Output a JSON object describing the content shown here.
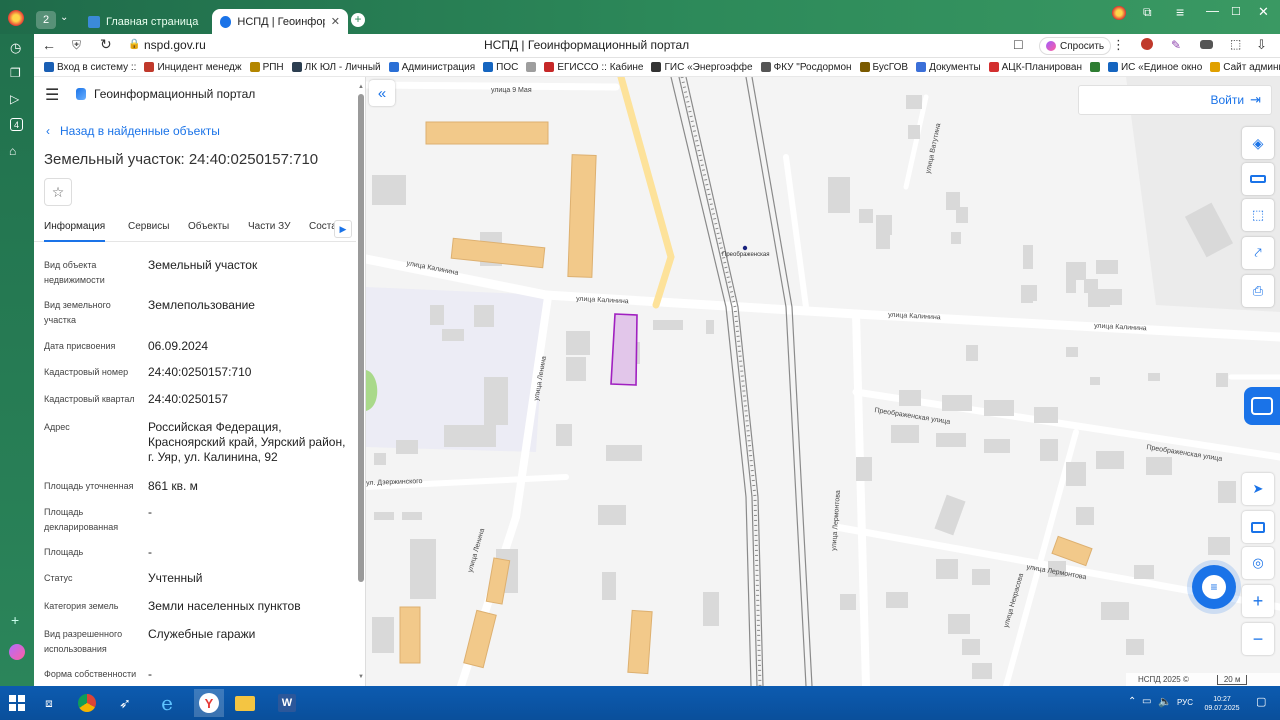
{
  "browser": {
    "tab_count": "2",
    "tabs": [
      {
        "title": "Главная страница",
        "active": false
      },
      {
        "title": "НСПД | Геоинформацио",
        "active": true
      }
    ],
    "address": "nspd.gov.ru",
    "page_title": "НСПД | Геоинформационный портал",
    "ask_label": "Спросить",
    "bookmarks": [
      {
        "label": "Вход в систему ::",
        "color": "#1a5fb4"
      },
      {
        "label": "Инцидент менедж",
        "color": "#c0392b"
      },
      {
        "label": "РПН",
        "color": "#b38600"
      },
      {
        "label": "ЛК ЮЛ - Личный",
        "color": "#2c3e50"
      },
      {
        "label": "Администрация",
        "color": "#2a6fd6"
      },
      {
        "label": "ПОС",
        "color": "#1565c0"
      },
      {
        "label": "",
        "color": "#9e9e9e"
      },
      {
        "label": "ЕГИССО :: Кабине",
        "color": "#c62828"
      },
      {
        "label": "ГИС «Энергоэффе",
        "color": "#333333"
      },
      {
        "label": "ФКУ \"Росдормон",
        "color": "#555555"
      },
      {
        "label": "БусГОВ",
        "color": "#7a5a00"
      },
      {
        "label": "Документы",
        "color": "#3b6fd8"
      },
      {
        "label": "АЦК-Планирован",
        "color": "#d32f2f"
      },
      {
        "label": "",
        "color": "#2e7d32"
      },
      {
        "label": "ИС «Единое окно",
        "color": "#1565c0"
      },
      {
        "label": "Сайт администрат",
        "color": "#e0a000"
      }
    ]
  },
  "panel": {
    "header_title": "Геоинформационный портал",
    "back_link": "Назад в найденные объекты",
    "object_title": "Земельный участок: 24:40:0250157:710",
    "tabs": [
      "Информация",
      "Сервисы",
      "Объекты",
      "Части ЗУ",
      "Соста"
    ],
    "fields": [
      {
        "label": "Вид объекта недвижимости",
        "value": "Земельный участок"
      },
      {
        "label": "Вид земельного участка",
        "value": "Землепользование"
      },
      {
        "label": "Дата присвоения",
        "value": "06.09.2024"
      },
      {
        "label": "Кадастровый номер",
        "value": "24:40:0250157:710"
      },
      {
        "label": "Кадастровый квартал",
        "value": "24:40:0250157"
      },
      {
        "label": "Адрес",
        "value": "Российская Федерация, Красноярский край, Уярский район, г. Уяр, ул. Калинина, 92"
      },
      {
        "label": "Площадь уточненная",
        "value": "861 кв. м"
      },
      {
        "label": "Площадь декларированная",
        "value": "-"
      },
      {
        "label": "Площадь",
        "value": "-"
      },
      {
        "label": "Статус",
        "value": "Учтенный"
      },
      {
        "label": "Категория земель",
        "value": "Земли населенных пунктов"
      },
      {
        "label": "Вид разрешенного использования",
        "value": "Служебные гаражи"
      },
      {
        "label": "Форма собственности",
        "value": "-"
      }
    ]
  },
  "map": {
    "login_label": "Войти",
    "streets": {
      "may9": "улица 9 Мая",
      "kalinina1": "улица Калинина",
      "kalinina2": "улица Калинина",
      "kalinina3": "улица Калинина",
      "kalinina4": "улица Калинина",
      "lenina1": "улица Ленина",
      "lenina2": "улица Ленина",
      "preob1": "Преображенская улица",
      "preob2": "Преображенская улица",
      "lermontova1": "улица Лермонтова",
      "lermontova2": "улица Лермонтова",
      "nekrasova": "улица Некрасова",
      "vatutina": "улица Ватутина",
      "dzerzh": "ул. Дзержинского",
      "station": "Преображенская"
    },
    "footer_copyright": "НСПД 2025 ©",
    "scale_label": "20 м"
  },
  "taskbar": {
    "time": "10:27",
    "date": "09.07.2025",
    "lang": "РУС"
  },
  "colors": {
    "accent": "#1a73e8",
    "parcel_stroke": "#a020c0",
    "parcel_fill": "#e2c6ea",
    "building": "#d9d9d9",
    "building_highlight": "#f2c98a",
    "road_highlight": "#fde29a"
  }
}
